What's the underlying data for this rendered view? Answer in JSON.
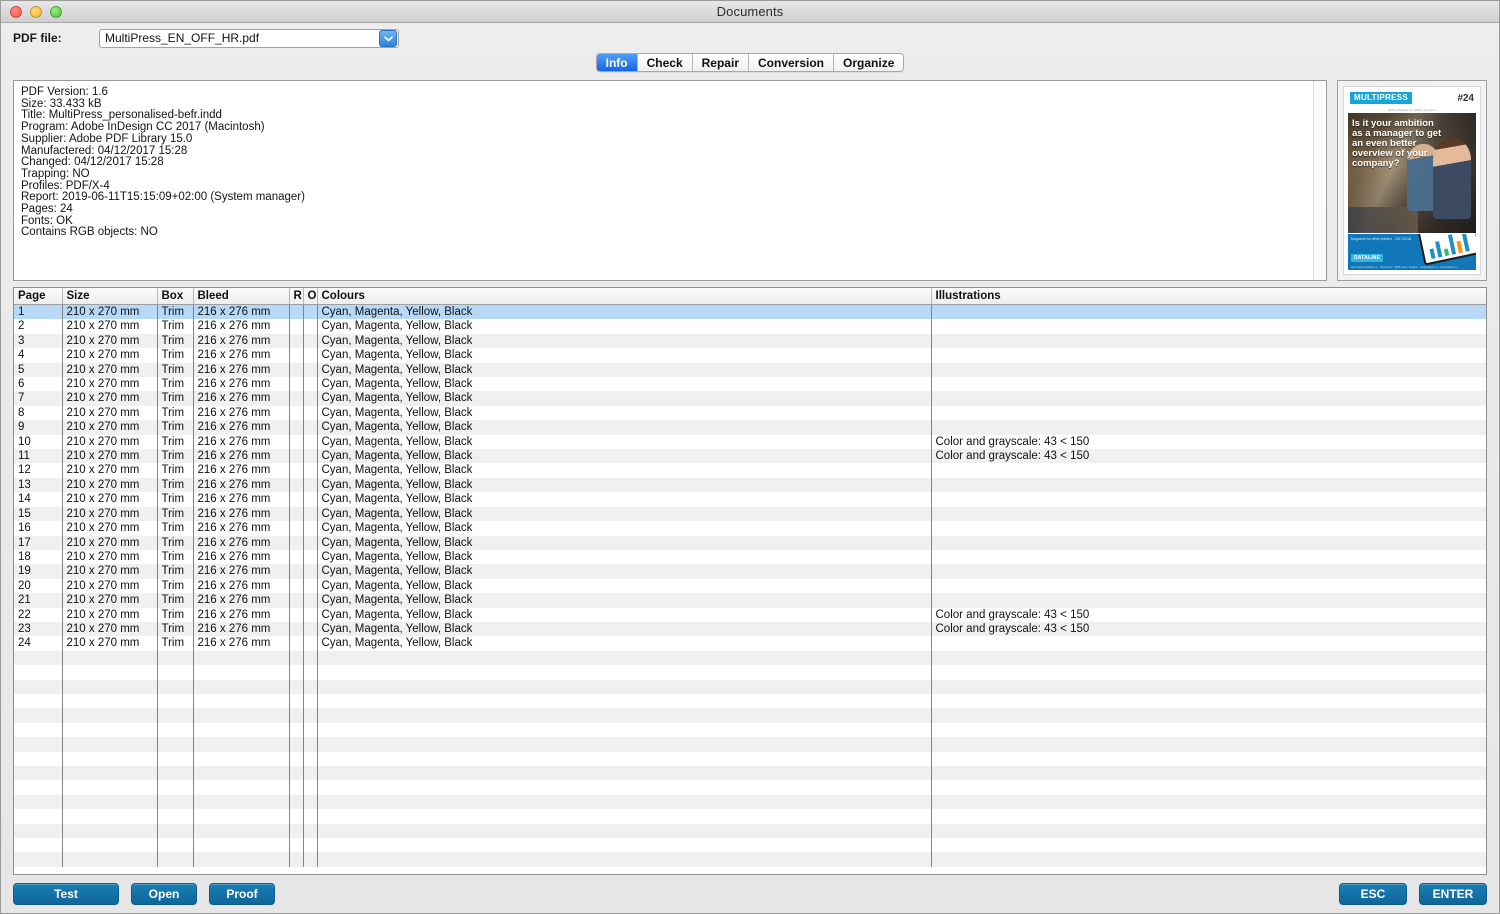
{
  "window": {
    "title": "Documents",
    "traffic_lights": [
      "close",
      "minimize",
      "zoom"
    ]
  },
  "file_selector": {
    "label": "PDF file:",
    "value": "MultiPress_EN_OFF_HR.pdf",
    "dropdown_icon": "chevron-down-icon"
  },
  "tabs": [
    {
      "label": "Info",
      "active": true
    },
    {
      "label": "Check",
      "active": false
    },
    {
      "label": "Repair",
      "active": false
    },
    {
      "label": "Conversion",
      "active": false
    },
    {
      "label": "Organize",
      "active": false
    }
  ],
  "info_panel": {
    "text": "PDF Version: 1.6\nSize: 33.433 kB\nTitle: MultiPress_personalised-befr.indd\nProgram: Adobe InDesign CC 2017 (Macintosh)\nSupplier: Adobe PDF Library 15.0\nManufactered: 04/12/2017 15:28\nChanged: 04/12/2017 15:28\nTrapping: NO\nProfiles: PDF/X-4\nReport: 2019-06-11T15:15:09+02:00 (System manager)\nPages: 24\nFonts: OK\nContains RGB objects: NO",
    "fields": [
      {
        "key": "PDF Version",
        "value": "1.6"
      },
      {
        "key": "Size",
        "value": "33.433 kB"
      },
      {
        "key": "Title",
        "value": "MultiPress_personalised-befr.indd"
      },
      {
        "key": "Program",
        "value": "Adobe InDesign CC 2017 (Macintosh)"
      },
      {
        "key": "Supplier",
        "value": "Adobe PDF Library 15.0"
      },
      {
        "key": "Manufactered",
        "value": "04/12/2017 15:28"
      },
      {
        "key": "Changed",
        "value": "04/12/2017 15:28"
      },
      {
        "key": "Trapping",
        "value": "NO"
      },
      {
        "key": "Profiles",
        "value": "PDF/X-4"
      },
      {
        "key": "Report",
        "value": "2019-06-11T15:15:09+02:00 (System manager)"
      },
      {
        "key": "Pages",
        "value": "24"
      },
      {
        "key": "Fonts",
        "value": "OK"
      },
      {
        "key": "Contains RGB objects",
        "value": "NO"
      }
    ]
  },
  "thumbnail": {
    "brand": "MULTIPRESS",
    "issue": "#24",
    "tagline": "MIS software for offset printers",
    "headline": "Is it your ambition as a manager to get an even better overview of your company?",
    "footer_note": "Magazine for offset printers -\n2017/2018",
    "footer_brand": "DATALINE",
    "footer_fine": "Our solutions Dataline nv - Hulstraat 27 - 8800 Leper - Belgium - info@dataline.eu - www.dataline.eu"
  },
  "table": {
    "columns": [
      "Page",
      "Size",
      "Box",
      "Bleed",
      "R",
      "O",
      "Colours",
      "Illustrations"
    ],
    "rows": [
      {
        "page": "1",
        "size": "210 x 270 mm",
        "box": "Trim",
        "bleed": "216 x 276 mm",
        "r": "",
        "o": "",
        "colours": "Cyan, Magenta, Yellow, Black",
        "illustrations": "",
        "selected": true
      },
      {
        "page": "2",
        "size": "210 x 270 mm",
        "box": "Trim",
        "bleed": "216 x 276 mm",
        "r": "",
        "o": "",
        "colours": "Cyan, Magenta, Yellow, Black",
        "illustrations": ""
      },
      {
        "page": "3",
        "size": "210 x 270 mm",
        "box": "Trim",
        "bleed": "216 x 276 mm",
        "r": "",
        "o": "",
        "colours": "Cyan, Magenta, Yellow, Black",
        "illustrations": ""
      },
      {
        "page": "4",
        "size": "210 x 270 mm",
        "box": "Trim",
        "bleed": "216 x 276 mm",
        "r": "",
        "o": "",
        "colours": "Cyan, Magenta, Yellow, Black",
        "illustrations": ""
      },
      {
        "page": "5",
        "size": "210 x 270 mm",
        "box": "Trim",
        "bleed": "216 x 276 mm",
        "r": "",
        "o": "",
        "colours": "Cyan, Magenta, Yellow, Black",
        "illustrations": ""
      },
      {
        "page": "6",
        "size": "210 x 270 mm",
        "box": "Trim",
        "bleed": "216 x 276 mm",
        "r": "",
        "o": "",
        "colours": "Cyan, Magenta, Yellow, Black",
        "illustrations": ""
      },
      {
        "page": "7",
        "size": "210 x 270 mm",
        "box": "Trim",
        "bleed": "216 x 276 mm",
        "r": "",
        "o": "",
        "colours": "Cyan, Magenta, Yellow, Black",
        "illustrations": ""
      },
      {
        "page": "8",
        "size": "210 x 270 mm",
        "box": "Trim",
        "bleed": "216 x 276 mm",
        "r": "",
        "o": "",
        "colours": "Cyan, Magenta, Yellow, Black",
        "illustrations": ""
      },
      {
        "page": "9",
        "size": "210 x 270 mm",
        "box": "Trim",
        "bleed": "216 x 276 mm",
        "r": "",
        "o": "",
        "colours": "Cyan, Magenta, Yellow, Black",
        "illustrations": ""
      },
      {
        "page": "10",
        "size": "210 x 270 mm",
        "box": "Trim",
        "bleed": "216 x 276 mm",
        "r": "",
        "o": "",
        "colours": "Cyan, Magenta, Yellow, Black",
        "illustrations": "Color and grayscale: 43 < 150"
      },
      {
        "page": "11",
        "size": "210 x 270 mm",
        "box": "Trim",
        "bleed": "216 x 276 mm",
        "r": "",
        "o": "",
        "colours": "Cyan, Magenta, Yellow, Black",
        "illustrations": "Color and grayscale: 43 < 150"
      },
      {
        "page": "12",
        "size": "210 x 270 mm",
        "box": "Trim",
        "bleed": "216 x 276 mm",
        "r": "",
        "o": "",
        "colours": "Cyan, Magenta, Yellow, Black",
        "illustrations": ""
      },
      {
        "page": "13",
        "size": "210 x 270 mm",
        "box": "Trim",
        "bleed": "216 x 276 mm",
        "r": "",
        "o": "",
        "colours": "Cyan, Magenta, Yellow, Black",
        "illustrations": ""
      },
      {
        "page": "14",
        "size": "210 x 270 mm",
        "box": "Trim",
        "bleed": "216 x 276 mm",
        "r": "",
        "o": "",
        "colours": "Cyan, Magenta, Yellow, Black",
        "illustrations": ""
      },
      {
        "page": "15",
        "size": "210 x 270 mm",
        "box": "Trim",
        "bleed": "216 x 276 mm",
        "r": "",
        "o": "",
        "colours": "Cyan, Magenta, Yellow, Black",
        "illustrations": ""
      },
      {
        "page": "16",
        "size": "210 x 270 mm",
        "box": "Trim",
        "bleed": "216 x 276 mm",
        "r": "",
        "o": "",
        "colours": "Cyan, Magenta, Yellow, Black",
        "illustrations": ""
      },
      {
        "page": "17",
        "size": "210 x 270 mm",
        "box": "Trim",
        "bleed": "216 x 276 mm",
        "r": "",
        "o": "",
        "colours": "Cyan, Magenta, Yellow, Black",
        "illustrations": ""
      },
      {
        "page": "18",
        "size": "210 x 270 mm",
        "box": "Trim",
        "bleed": "216 x 276 mm",
        "r": "",
        "o": "",
        "colours": "Cyan, Magenta, Yellow, Black",
        "illustrations": ""
      },
      {
        "page": "19",
        "size": "210 x 270 mm",
        "box": "Trim",
        "bleed": "216 x 276 mm",
        "r": "",
        "o": "",
        "colours": "Cyan, Magenta, Yellow, Black",
        "illustrations": ""
      },
      {
        "page": "20",
        "size": "210 x 270 mm",
        "box": "Trim",
        "bleed": "216 x 276 mm",
        "r": "",
        "o": "",
        "colours": "Cyan, Magenta, Yellow, Black",
        "illustrations": ""
      },
      {
        "page": "21",
        "size": "210 x 270 mm",
        "box": "Trim",
        "bleed": "216 x 276 mm",
        "r": "",
        "o": "",
        "colours": "Cyan, Magenta, Yellow, Black",
        "illustrations": ""
      },
      {
        "page": "22",
        "size": "210 x 270 mm",
        "box": "Trim",
        "bleed": "216 x 276 mm",
        "r": "",
        "o": "",
        "colours": "Cyan, Magenta, Yellow, Black",
        "illustrations": "Color and grayscale: 43 < 150"
      },
      {
        "page": "23",
        "size": "210 x 270 mm",
        "box": "Trim",
        "bleed": "216 x 276 mm",
        "r": "",
        "o": "",
        "colours": "Cyan, Magenta, Yellow, Black",
        "illustrations": "Color and grayscale: 43 < 150"
      },
      {
        "page": "24",
        "size": "210 x 270 mm",
        "box": "Trim",
        "bleed": "216 x 276 mm",
        "r": "",
        "o": "",
        "colours": "Cyan, Magenta, Yellow, Black",
        "illustrations": ""
      }
    ],
    "empty_row_count": 15
  },
  "footer": {
    "test_label": "Test",
    "open_label": "Open",
    "proof_label": "Proof",
    "esc_label": "ESC",
    "enter_label": "ENTER"
  },
  "colors": {
    "accent_blue": "#0f6699",
    "tab_active": "#1664e8",
    "selection": "#b6d9f7",
    "stripe": "#f0f0f0",
    "brand_cyan": "#17a4d6"
  }
}
